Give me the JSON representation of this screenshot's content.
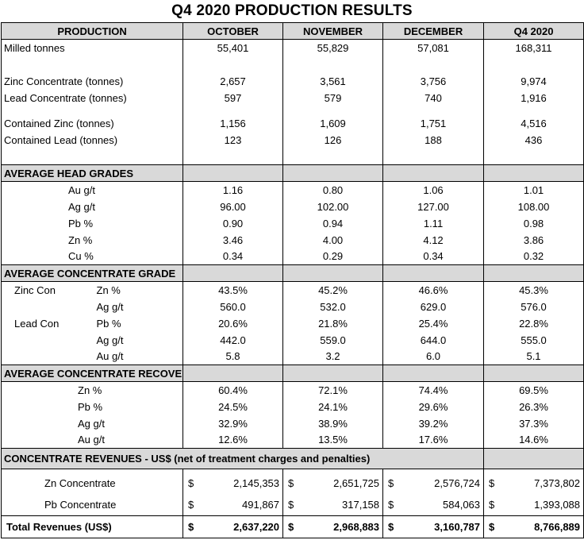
{
  "title": "Q4 2020 PRODUCTION RESULTS",
  "headers": [
    "PRODUCTION",
    "OCTOBER",
    "NOVEMBER",
    "DECEMBER",
    "Q4 2020"
  ],
  "milled": {
    "label": "Milled tonnes",
    "values": [
      "55,401",
      "55,829",
      "57,081",
      "168,311"
    ]
  },
  "concentrate": [
    {
      "label": "Zinc Concentrate (tonnes)",
      "values": [
        "2,657",
        "3,561",
        "3,756",
        "9,974"
      ]
    },
    {
      "label": "Lead Concentrate (tonnes)",
      "values": [
        "597",
        "579",
        "740",
        "1,916"
      ]
    }
  ],
  "contained": [
    {
      "label": "Contained Zinc (tonnes)",
      "values": [
        "1,156",
        "1,609",
        "1,751",
        "4,516"
      ]
    },
    {
      "label": "Contained Lead (tonnes)",
      "values": [
        "123",
        "126",
        "188",
        "436"
      ]
    }
  ],
  "head_grades": {
    "title": "AVERAGE HEAD GRADES",
    "rows": [
      {
        "label": "Au g/t",
        "values": [
          "1.16",
          "0.80",
          "1.06",
          "1.01"
        ]
      },
      {
        "label": "Ag  g/t",
        "values": [
          "96.00",
          "102.00",
          "127.00",
          "108.00"
        ]
      },
      {
        "label": "Pb %",
        "values": [
          "0.90",
          "0.94",
          "1.11",
          "0.98"
        ]
      },
      {
        "label": "Zn %",
        "values": [
          "3.46",
          "4.00",
          "4.12",
          "3.86"
        ]
      },
      {
        "label": "Cu %",
        "values": [
          "0.34",
          "0.29",
          "0.34",
          "0.32"
        ]
      }
    ]
  },
  "conc_grade": {
    "title": "AVERAGE CONCENTRATE GRADE",
    "zinc": {
      "name": "Zinc Con",
      "rows": [
        {
          "label": "Zn %",
          "values": [
            "43.5%",
            "45.2%",
            "46.6%",
            "45.3%"
          ]
        },
        {
          "label": "Ag g/t",
          "values": [
            "560.0",
            "532.0",
            "629.0",
            "576.0"
          ]
        }
      ]
    },
    "lead": {
      "name": "Lead Con",
      "rows": [
        {
          "label": "Pb %",
          "values": [
            "20.6%",
            "21.8%",
            "25.4%",
            "22.8%"
          ]
        },
        {
          "label": "Ag g/t",
          "values": [
            "442.0",
            "559.0",
            "644.0",
            "555.0"
          ]
        },
        {
          "label": "Au g/t",
          "values": [
            "5.8",
            "3.2",
            "6.0",
            "5.1"
          ]
        }
      ]
    }
  },
  "recoveries": {
    "title": "AVERAGE CONCENTRATE RECOVERIES",
    "rows": [
      {
        "label": "Zn %",
        "values": [
          "60.4%",
          "72.1%",
          "74.4%",
          "69.5%"
        ]
      },
      {
        "label": "Pb %",
        "values": [
          "24.5%",
          "24.1%",
          "29.6%",
          "26.3%"
        ]
      },
      {
        "label": "Ag g/t",
        "values": [
          "32.9%",
          "38.9%",
          "39.2%",
          "37.3%"
        ]
      },
      {
        "label": "Au g/t",
        "values": [
          "12.6%",
          "13.5%",
          "17.6%",
          "14.6%"
        ]
      }
    ]
  },
  "revenues": {
    "title": "CONCENTRATE REVENUES - US$ (net of treatment charges and penalties)",
    "currency": "$",
    "rows": [
      {
        "label": "Zn Concentrate",
        "values": [
          "2,145,353",
          "2,651,725",
          "2,576,724",
          "7,373,802"
        ]
      },
      {
        "label": "Pb Concentrate",
        "values": [
          "491,867",
          "317,158",
          "584,063",
          "1,393,088"
        ]
      }
    ],
    "total": {
      "label": "Total Revenues (US$)",
      "values": [
        "2,637,220",
        "2,968,883",
        "3,160,787",
        "8,766,889"
      ]
    }
  }
}
